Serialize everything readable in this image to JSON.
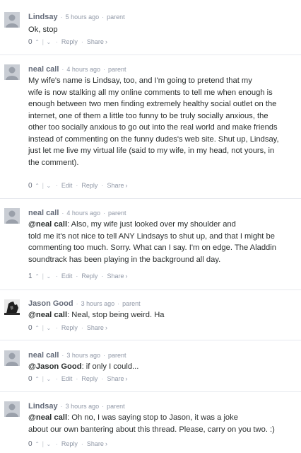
{
  "labels": {
    "parent": "parent",
    "reply": "Reply",
    "edit": "Edit",
    "share": "Share",
    "share_chevron": "›",
    "separator": "·",
    "vote_up": "⌃",
    "vote_down": "⌄",
    "vote_sep": "|"
  },
  "comments": [
    {
      "author": "Lindsay",
      "time": "5 hours ago",
      "mention": "",
      "lines": [
        "Ok, stop"
      ],
      "votes": "0",
      "avatar": "default-avatar-icon"
    },
    {
      "author": "neal call",
      "time": "4 hours ago",
      "mention": "",
      "lines": [
        "My wife's name is Lindsay, too, and I'm going to pretend that my",
        "wife is now stalking all my online comments to tell me when enough is",
        "enough between two men finding extremely healthy social outlet on the",
        "internet, one of them a little too funny to be truly socially anxious, the",
        "other too socially anxious to go out into the real world and make friends",
        "instead of commenting on the funny dudes's web site. Shut up, Lindsay,",
        "just let me live my virtual life (said to my wife, in my head, not yours, in",
        "the comment)."
      ],
      "votes": "0",
      "avatar": "default-avatar-icon"
    },
    {
      "author": "neal call",
      "time": "4 hours ago",
      "mention": "@neal call",
      "lines": [
        ": Also, my wife just looked over my shoulder and",
        "told me it's not nice to tell ANY Lindsays to shut up, and that I might be",
        "commenting too much. Sorry. What can I say. I'm on edge. The Aladdin",
        "soundtrack has been playing in the background all day."
      ],
      "votes": "1",
      "avatar": "default-avatar-icon"
    },
    {
      "author": "Jason Good",
      "time": "3 hours ago",
      "mention": "@neal call",
      "lines": [
        ": Neal, stop being weird. Ha"
      ],
      "votes": "0",
      "avatar": "photo-avatar-icon"
    },
    {
      "author": "neal call",
      "time": "3 hours ago",
      "mention": "@Jason Good",
      "lines": [
        ": if only I could..."
      ],
      "votes": "0",
      "avatar": "default-avatar-icon"
    },
    {
      "author": "Lindsay",
      "time": "3 hours ago",
      "mention": "@neal call",
      "lines": [
        ": Oh no, I was saying stop to Jason, it was a joke",
        "about our own bantering about this thread. Please, carry on you two. :)"
      ],
      "votes": "0",
      "avatar": "default-avatar-icon"
    }
  ],
  "colors": {
    "author": "#656c7a",
    "meta": "#8f97a6",
    "body": "#2a2e2e",
    "divider": "#e7e9ee",
    "avatar_default": "#c9cdd4"
  }
}
